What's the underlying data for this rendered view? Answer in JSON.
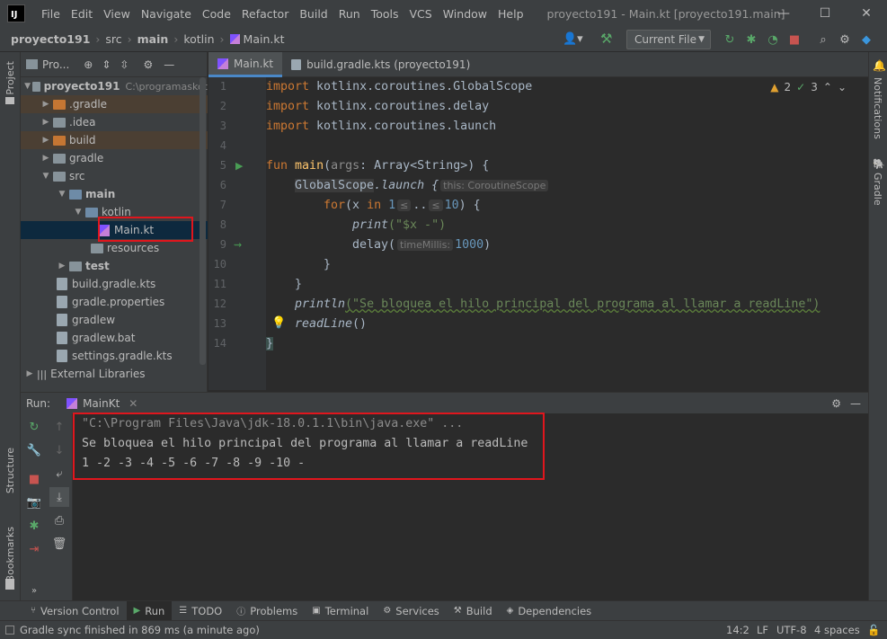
{
  "window": {
    "logo": "IJ",
    "menu": [
      "File",
      "Edit",
      "View",
      "Navigate",
      "Code",
      "Refactor",
      "Build",
      "Run",
      "Tools",
      "VCS",
      "Window",
      "Help"
    ],
    "title": "proyecto191 - Main.kt [proyecto191.main]"
  },
  "breadcrumb": {
    "project": "proyecto191",
    "src": "src",
    "main": "main",
    "kotlin": "kotlin",
    "file": "Main.kt"
  },
  "run_config": "Current File",
  "project_panel": {
    "title": "Pro...",
    "root_name": "proyecto191",
    "root_path": "C:\\programaskot",
    "items": [
      {
        "label": ".gradle",
        "kind": "folder-o"
      },
      {
        "label": ".idea",
        "kind": "folder-g"
      },
      {
        "label": "build",
        "kind": "folder-o"
      },
      {
        "label": "gradle",
        "kind": "folder-g"
      },
      {
        "label": "src",
        "kind": "folder-g"
      },
      {
        "label": "main",
        "kind": "folder-b"
      },
      {
        "label": "kotlin",
        "kind": "folder-b"
      },
      {
        "label": "Main.kt",
        "kind": "kt"
      },
      {
        "label": "resources",
        "kind": "folder-g"
      },
      {
        "label": "test",
        "kind": "folder-g"
      },
      {
        "label": "build.gradle.kts",
        "kind": "file"
      },
      {
        "label": "gradle.properties",
        "kind": "file"
      },
      {
        "label": "gradlew",
        "kind": "file"
      },
      {
        "label": "gradlew.bat",
        "kind": "file"
      },
      {
        "label": "settings.gradle.kts",
        "kind": "file"
      },
      {
        "label": "External Libraries",
        "kind": "lib"
      }
    ]
  },
  "tabs": [
    "Main.kt",
    "build.gradle.kts (proyecto191)"
  ],
  "inspections": {
    "warnings": "2",
    "weak": "3"
  },
  "code": {
    "line_numbers": [
      "1",
      "2",
      "3",
      "4",
      "5",
      "6",
      "7",
      "8",
      "9",
      "10",
      "11",
      "12",
      "13",
      "14"
    ],
    "import1": "import",
    "import1_path": " kotlinx.coroutines.GlobalScope",
    "import2_path": " kotlinx.coroutines.delay",
    "import3_path": " kotlinx.coroutines.launch",
    "fun_kw": "fun",
    "main_name": "main",
    "args_param": "args",
    "args_type": ": Array<String>) {",
    "globalscope": "GlobalScope",
    "launch": ".launch {",
    "this_hint": "this: CoroutineScope",
    "for_kw": "for",
    "x_var": "(x",
    "in_kw": "in",
    "range_start": "1",
    "range_hint1": "≤",
    "range_dots": "..",
    "range_hint2": "≤",
    "range_end": "10",
    "range_close": ") {",
    "print_fn": "print",
    "print_arg": "(\"$x -\")",
    "delay_fn": "delay(",
    "delay_hint": "timeMillis:",
    "delay_value": "1000",
    "delay_close": ")",
    "close_brace": "}",
    "println_fn": "println",
    "println_arg": "(\"Se bloquea el hilo principal del programa al llamar a readLine\")",
    "readline_fn": "readLine",
    "readline_paren": "()"
  },
  "run_panel": {
    "run_label": "Run:",
    "config_name": "MainKt",
    "output": [
      "\"C:\\Program Files\\Java\\jdk-18.0.1.1\\bin\\java.exe\" ...",
      "Se bloquea el hilo principal del programa al llamar a readLine",
      "1 -2 -3 -4 -5 -6 -7 -8 -9 -10 -"
    ]
  },
  "left_strip": {
    "project": "Project",
    "structure": "Structure",
    "bookmarks": "Bookmarks"
  },
  "right_strip": {
    "notifications": "Notifications",
    "gradle": "Gradle"
  },
  "tool_windows": [
    "Version Control",
    "Run",
    "TODO",
    "Problems",
    "Terminal",
    "Services",
    "Build",
    "Dependencies"
  ],
  "status": {
    "message": "Gradle sync finished in 869 ms (a minute ago)",
    "position": "14:2",
    "line_sep": "LF",
    "encoding": "UTF-8",
    "indent": "4 spaces"
  }
}
